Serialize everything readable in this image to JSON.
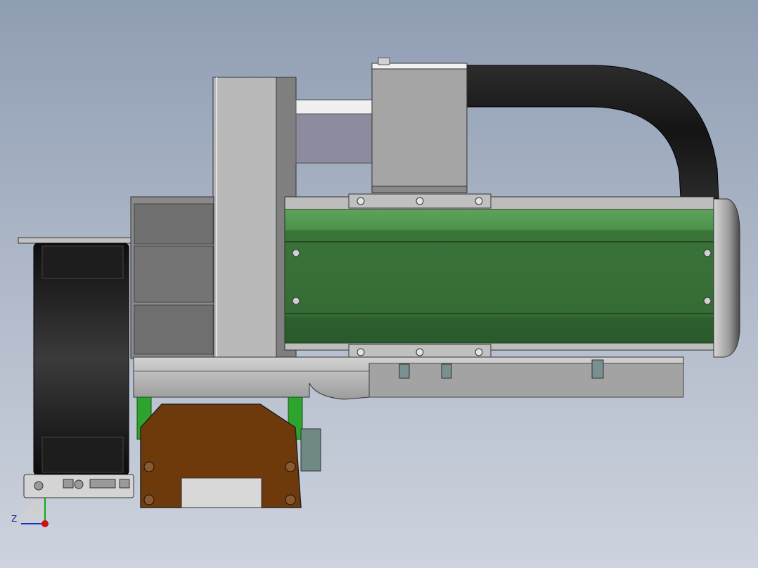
{
  "view": {
    "background_top": "#8f9db3",
    "background_bottom": "#cdd3de"
  },
  "colors": {
    "housing_green": "#3d7a3c",
    "housing_green_light": "#56a056",
    "housing_green_dark": "#2f5f30",
    "carriage_brown": "#6e3a0c",
    "cable_black": "#1a1a1a",
    "metal_gray": "#a8a8a8",
    "metal_dark": "#6b6b6b",
    "plate_light": "#c8c8c8"
  },
  "triad": {
    "z_label": "Z",
    "x_axis_color": "#cc1111",
    "y_axis_color": "#11aa11",
    "z_axis_color": "#1133cc"
  }
}
